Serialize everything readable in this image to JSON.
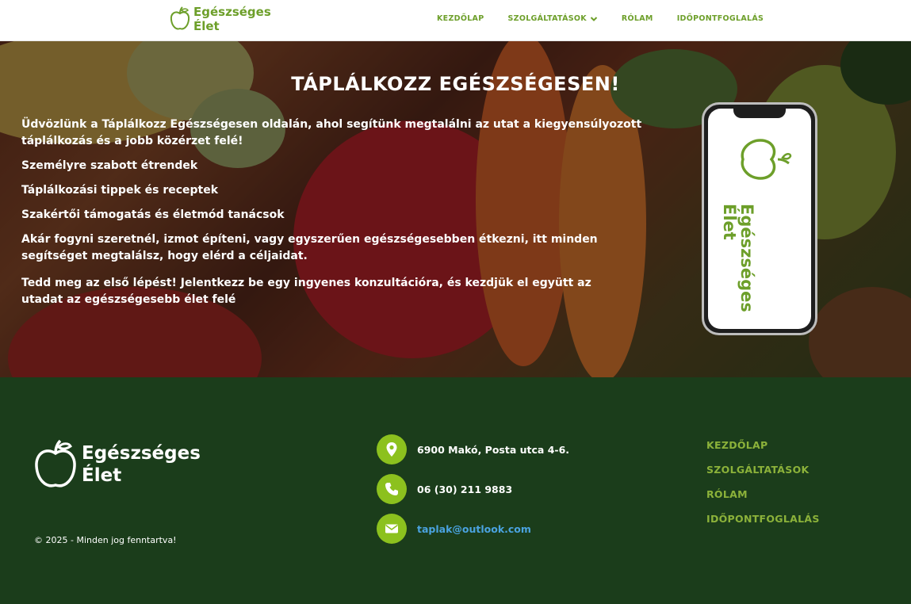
{
  "header": {
    "logo_line1": "Egészséges",
    "logo_line2": "Élet",
    "nav": [
      "KEZDŐLAP",
      "SZOLGÁLTATÁSOK",
      "RÓLAM",
      "IDŐPONTFOGLALÁS"
    ]
  },
  "hero": {
    "title": "TÁPLÁLKOZZ EGÉSZSÉGESEN!",
    "paragraphs": [
      "Üdvözlünk a Táplálkozz Egészségesen oldalán, ahol segítünk megtalálni az utat a kiegyensúlyozott táplálkozás és a jobb közérzet felé!",
      "Személyre szabott étrendek",
      "Táplálkozási tippek és receptek",
      "Szakértői támogatás és életmód tanácsok",
      "Akár fogyni szeretnél, izmot építeni, vagy egyszerűen egészségesebben étkezni, itt minden segítséget megtalálsz, hogy elérd a céljaidat.",
      "Tedd meg az első lépést! Jelentkezz be egy ingyenes konzultációra, és kezdjük el együtt az utadat az egészségesebb élet felé"
    ],
    "phone_logo_line1": "Egészséges",
    "phone_logo_line2": "Élet"
  },
  "footer": {
    "logo_line1": "Egészséges",
    "logo_line2": "Élet",
    "copyright": "© 2025 - Minden jog fenntartva!",
    "address": "6900 Makó, Posta utca 4-6.",
    "phone": "06 (30) 211 9883",
    "email": "taplak@outlook.com",
    "nav": [
      "KEZDŐLAP",
      "SZOLGÁLTATÁSOK",
      "RÓLAM",
      "IDŐPONTFOGLALÁS"
    ]
  },
  "colors": {
    "brand_green": "#6d9f2a",
    "footer_bg": "#1b3d1b",
    "contact_circle": "#8cc11e",
    "email_link": "#4aa3e0"
  },
  "icons": {
    "logo": "apple-icon",
    "dropdown": "chevron-down-icon",
    "address": "map-pin-icon",
    "phone": "phone-icon",
    "email": "envelope-icon"
  }
}
